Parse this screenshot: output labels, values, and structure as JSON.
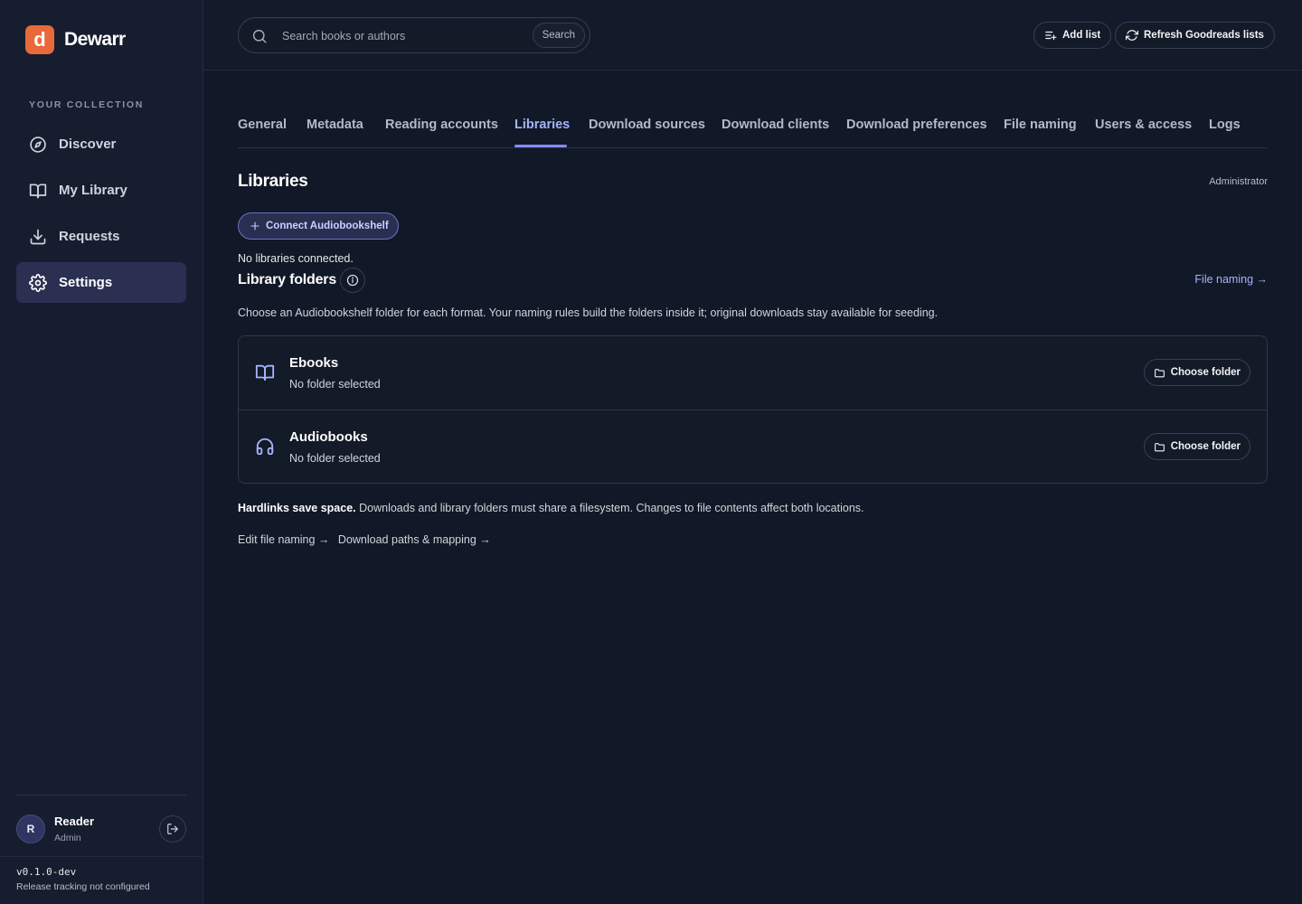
{
  "brand": {
    "logo_letter": "d",
    "name": "Dewarr"
  },
  "sidebar": {
    "section_label": "YOUR COLLECTION",
    "items": [
      {
        "label": "Discover",
        "icon": "compass-icon"
      },
      {
        "label": "My Library",
        "icon": "book-open-icon"
      },
      {
        "label": "Requests",
        "icon": "download-icon"
      },
      {
        "label": "Settings",
        "icon": "gear-icon",
        "active": true
      }
    ],
    "user": {
      "initial": "R",
      "name": "Reader",
      "role": "Admin"
    },
    "version": "v0.1.0-dev",
    "release_status": "Release tracking not configured"
  },
  "topbar": {
    "search_placeholder": "Search books or authors",
    "search_button": "Search",
    "add_list": "Add list",
    "refresh": "Refresh Goodreads lists"
  },
  "tabs": [
    {
      "label": "General"
    },
    {
      "label": "Metadata"
    },
    {
      "label": "Reading accounts"
    },
    {
      "label": "Libraries",
      "active": true
    },
    {
      "label": "Download sources"
    },
    {
      "label": "Download clients"
    },
    {
      "label": "Download preferences"
    },
    {
      "label": "File naming"
    },
    {
      "label": "Users & access"
    },
    {
      "label": "Logs"
    }
  ],
  "libraries": {
    "title": "Libraries",
    "role": "Administrator",
    "connect_button": "Connect Audiobookshelf",
    "empty_text": "No libraries connected."
  },
  "library_folders": {
    "title": "Library folders",
    "link": "File naming →",
    "description": "Choose an Audiobookshelf folder for each format. Your naming rules build the folders inside it; original downloads stay available for seeding.",
    "rows": [
      {
        "name": "Ebooks",
        "status": "No folder selected",
        "button": "Choose folder",
        "icon": "book-open-icon"
      },
      {
        "name": "Audiobooks",
        "status": "No folder selected",
        "button": "Choose folder",
        "icon": "headphones-icon"
      }
    ]
  },
  "hardlinks": {
    "bold": "Hardlinks save space.",
    "text": " Downloads and library folders must share a filesystem. Changes to file contents affect both locations."
  },
  "links": {
    "edit_naming": "Edit file naming →",
    "download_paths": "Download paths & mapping →"
  },
  "colors": {
    "background": "#111827",
    "sidebar": "#161d2e",
    "accent": "#818cf8",
    "brand": "#e8693a"
  }
}
